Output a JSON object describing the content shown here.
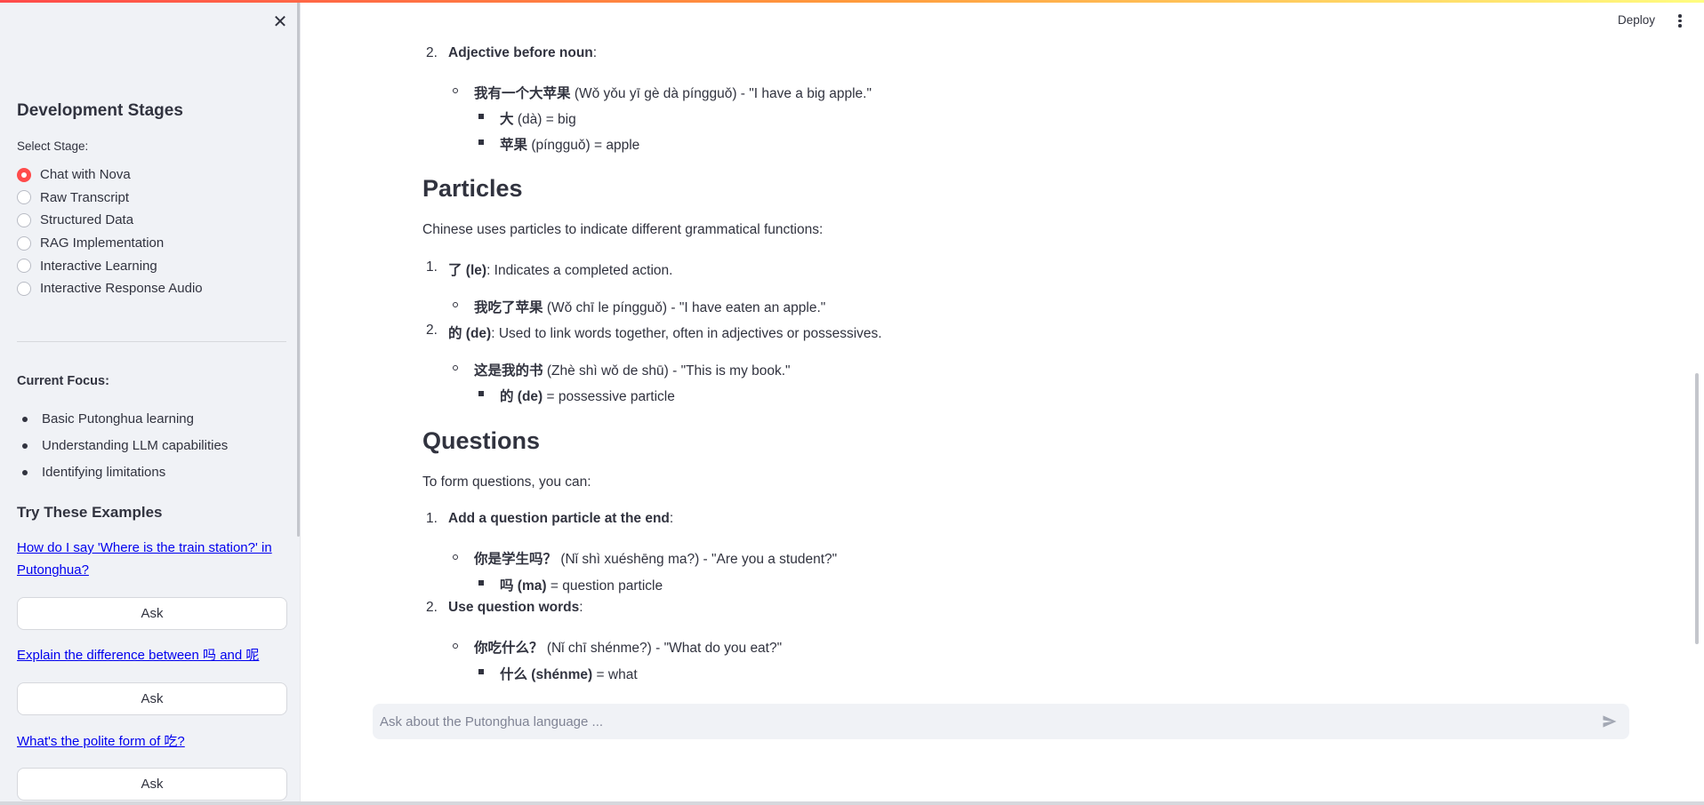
{
  "sidebar": {
    "close_icon": "close-icon",
    "title": "Development Stages",
    "select_label": "Select Stage:",
    "stages": [
      {
        "label": "Chat with Nova",
        "checked": true
      },
      {
        "label": "Raw Transcript",
        "checked": false
      },
      {
        "label": "Structured Data",
        "checked": false
      },
      {
        "label": "RAG Implementation",
        "checked": false
      },
      {
        "label": "Interactive Learning",
        "checked": false
      },
      {
        "label": "Interactive Response Audio",
        "checked": false
      }
    ],
    "focus_title": "Current Focus:",
    "focus_items": [
      "Basic Putonghua learning",
      "Understanding LLM capabilities",
      "Identifying limitations"
    ],
    "try_title": "Try These Examples",
    "examples": [
      {
        "text": "How do I say 'Where is the train station?' in Putonghua?",
        "button": "Ask"
      },
      {
        "text": "Explain the difference between 吗 and 呢",
        "button": "Ask"
      },
      {
        "text": "What's the polite form of 吃?",
        "button": "Ask"
      }
    ]
  },
  "header": {
    "deploy_label": "Deploy",
    "menu_icon": "kebab-menu-icon"
  },
  "content": {
    "adj": {
      "num": "2.",
      "title": "Adjective before noun",
      "example_zh": "我有一个大苹果",
      "example_rest": " (Wǒ yǒu yī gè dà píngguǒ) - \"I have a big apple.\"",
      "sub1_zh": "大",
      "sub1_rest": " (dà) = big",
      "sub2_zh": "苹果",
      "sub2_rest": " (píngguǒ) = apple"
    },
    "particles": {
      "heading": "Particles",
      "intro": "Chinese uses particles to indicate different grammatical functions:",
      "item1_num": "1.",
      "item1_term": "了 (le)",
      "item1_desc": ": Indicates a completed action.",
      "item1_ex_zh": "我吃了苹果",
      "item1_ex_rest": " (Wǒ chī le píngguǒ) - \"I have eaten an apple.\"",
      "item2_num": "2.",
      "item2_term": "的 (de)",
      "item2_desc": ": Used to link words together, often in adjectives or possessives.",
      "item2_ex_zh": "这是我的书",
      "item2_ex_rest": " (Zhè shì wǒ de shū) - \"This is my book.\"",
      "item2_sub_zh": "的 (de)",
      "item2_sub_rest": " = possessive particle"
    },
    "questions": {
      "heading": "Questions",
      "intro": "To form questions, you can:",
      "item1_num": "1.",
      "item1_term": "Add a question particle at the end",
      "item1_ex_zh": "你是学生吗？",
      "item1_ex_rest": " (Nǐ shì xuéshēng ma?) - \"Are you a student?\"",
      "item1_sub_zh": "吗 (ma)",
      "item1_sub_rest": " = question particle",
      "item2_num": "2.",
      "item2_term": "Use question words",
      "item2_ex_zh": "你吃什么？",
      "item2_ex_rest": " (Nǐ chī shénme?) - \"What do you eat?\"",
      "item2_sub_zh": "什么 (shénme)",
      "item2_sub_rest": " = what"
    },
    "colon": ":"
  },
  "chat": {
    "placeholder": "Ask about the Putonghua language ...",
    "send_icon": "send-icon"
  },
  "colors": {
    "accent": "#ff4b4b",
    "sidebar_bg": "#f0f2f6",
    "text": "#31333f",
    "link": "#0000ee"
  }
}
